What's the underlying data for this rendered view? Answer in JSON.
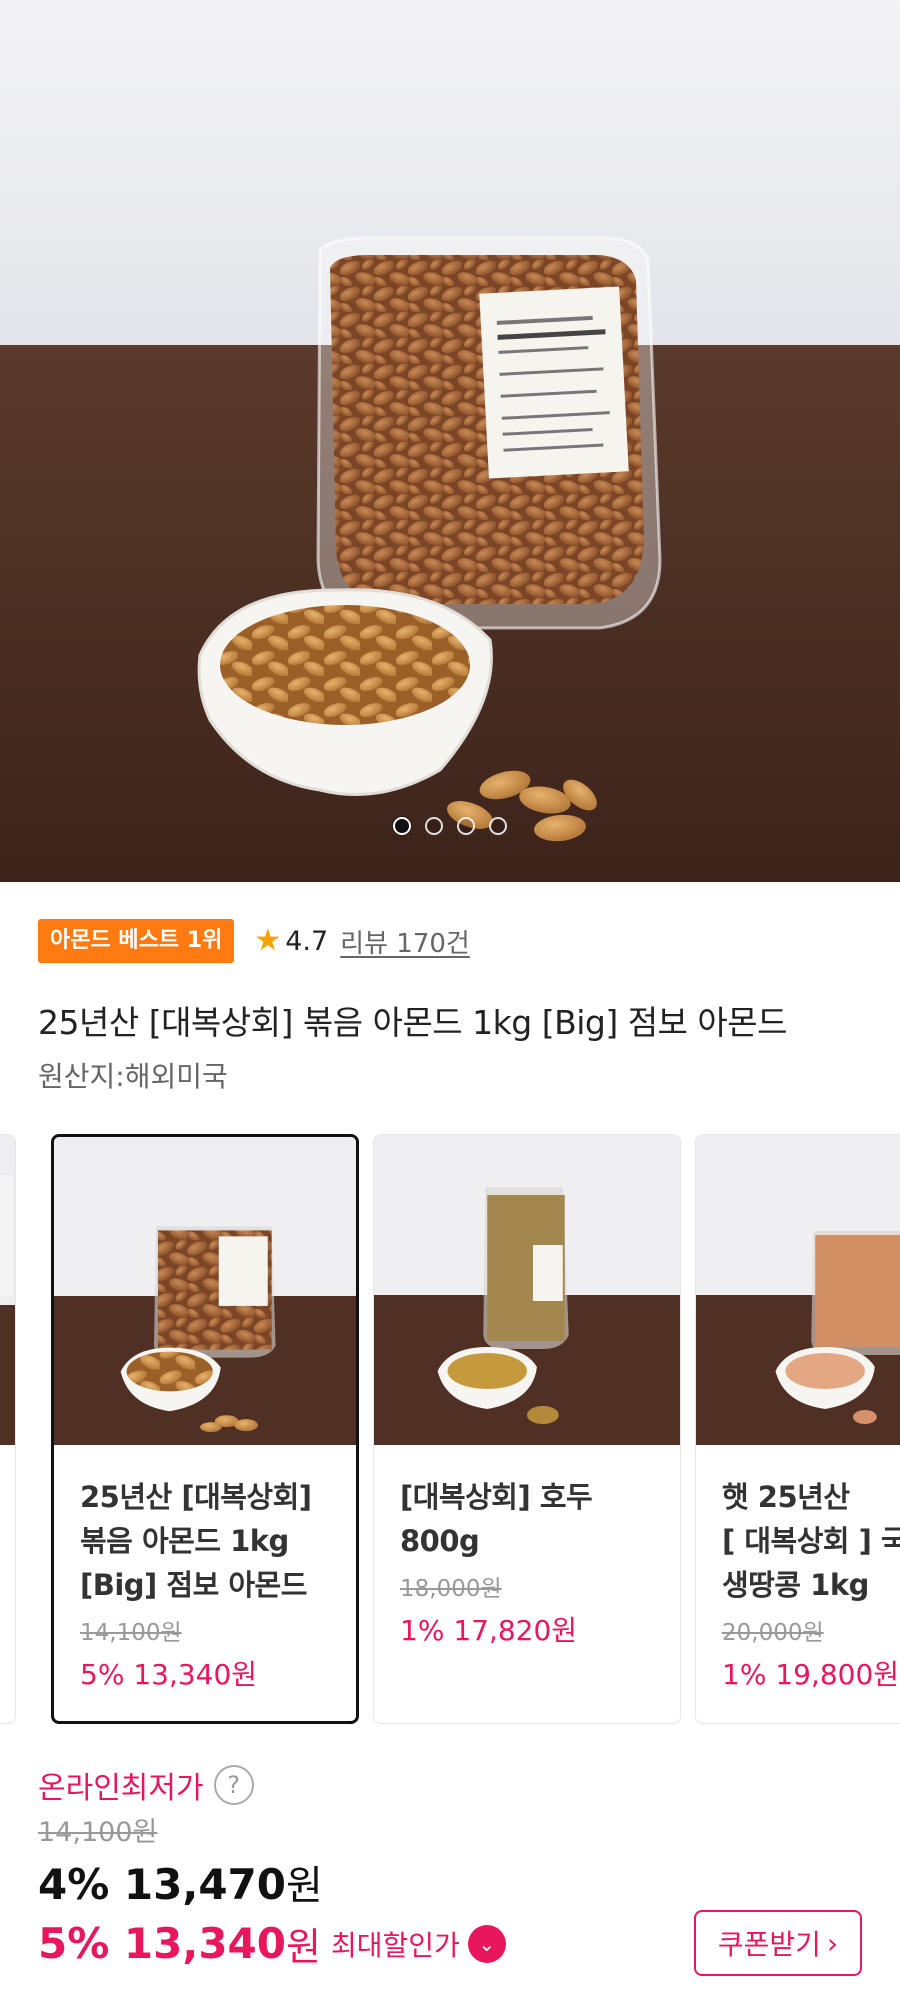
{
  "hero": {
    "dots": 4,
    "active_dot": 0,
    "bag_label_lines": [
      "(주)대복상회",
      "견과류꿀스럽하루견",
      "원산지:미국",
      "유통기한:별도표기일",
      "보관방법:직사광선",
      "피해 서늘한 곳 보관"
    ]
  },
  "badge": {
    "label": "아몬드 베스트 1위"
  },
  "rating": {
    "icon": "star-icon",
    "value": "4.7",
    "review_text": "리뷰 170건"
  },
  "product": {
    "title": "25년산 [대복상회] 볶음 아몬드 1kg [Big] 점보 아몬드",
    "origin": "원산지:해외미국"
  },
  "related": [
    {
      "name_lines": [
        "25년산 [대복상회]",
        "볶음 아몬드 1kg",
        "[Big] 점보 아몬드"
      ],
      "original_price": "14,100원",
      "sale_price": "5% 13,340원",
      "selected": true
    },
    {
      "name_lines": [
        "[대복상회] 호두",
        "800g",
        ""
      ],
      "original_price": "18,000원",
      "sale_price": "1% 17,820원",
      "selected": false
    },
    {
      "name_lines": [
        "햇 25년산",
        "[ 대복상회 ] 국",
        "생땅콩 1kg"
      ],
      "original_price": "20,000원",
      "sale_price": "1% 19,800원",
      "selected": false
    }
  ],
  "price": {
    "lowest_label": "온라인최저가",
    "help_icon": "question-icon",
    "list_price": "14,100원",
    "main_amount": "4% 13,470",
    "main_unit": "원",
    "best_amount": "5% 13,340",
    "best_unit": "원",
    "best_label": "최대할인가",
    "coupon_label": "쿠폰받기"
  },
  "colors": {
    "accent": "#e8175d",
    "badge": "#ff7a10",
    "star": "#f7a400"
  }
}
